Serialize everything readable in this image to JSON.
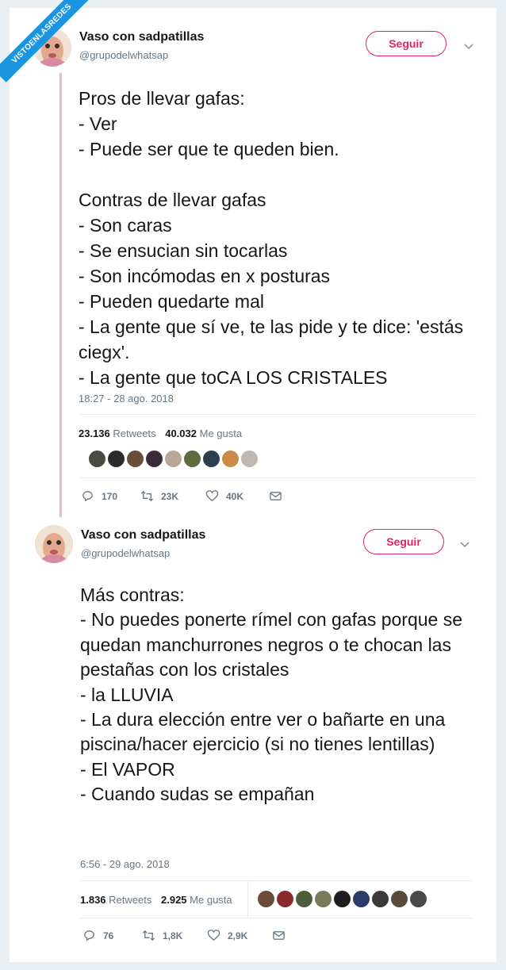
{
  "banner": {
    "text": "VISTOENLASREDES"
  },
  "tweets": [
    {
      "author": {
        "name": "Vaso con sadpatillas",
        "handle": "@grupodelwhatsap"
      },
      "follow_label": "Seguir",
      "text": "Pros de llevar gafas:\n- Ver\n- Puede ser que te queden bien.\n\nContras de llevar gafas\n- Son caras\n- Se ensucian sin tocarlas\n- Son incómodas en x posturas\n- Pueden quedarte mal\n- La gente que sí ve, te las pide y te dice: 'estás ciegx'.\n- La gente que toCA LOS CRISTALES",
      "timestamp": "18:27 - 28 ago. 2018",
      "retweets": {
        "count": "23.136",
        "label": "Retweets"
      },
      "likes": {
        "count": "40.032",
        "label": "Me gusta"
      },
      "liker_colors": [
        "#4a4a3e",
        "#2b2b2b",
        "#6b4e3a",
        "#3a2a3a",
        "#b8a69a",
        "#5d6b3e",
        "#2e3e4e",
        "#c98a4a",
        "#c0b8b0"
      ],
      "actions": {
        "replies": "170",
        "retweets": "23K",
        "likes": "40K"
      }
    },
    {
      "author": {
        "name": "Vaso con sadpatillas",
        "handle": "@grupodelwhatsap"
      },
      "follow_label": "Seguir",
      "text": "Más contras:\n- No puedes ponerte rímel con gafas porque se quedan manchurrones negros o te chocan las pestañas con los cristales\n- la LLUVIA\n- La dura elección entre ver o bañarte en una piscina/hacer ejercicio (si no tienes lentillas)\n- El VAPOR\n- Cuando sudas se empañan",
      "timestamp": "6:56 - 29 ago. 2018",
      "retweets": {
        "count": "1.836",
        "label": "Retweets"
      },
      "likes": {
        "count": "2.925",
        "label": "Me gusta"
      },
      "liker_colors": [
        "#6b4a3a",
        "#8a2a2a",
        "#4e5e3a",
        "#7a7a5a",
        "#1e1e1e",
        "#2a3a6a",
        "#3a3a3a",
        "#5a4a3a",
        "#4a4a4a"
      ],
      "actions": {
        "replies": "76",
        "retweets": "1,8K",
        "likes": "2,9K"
      }
    }
  ],
  "colors": {
    "accent": "#e0245e",
    "muted": "#657786",
    "thread_line": "#f2b5c2",
    "banner": "#1b95e0"
  },
  "icons": [
    "reply-icon",
    "retweet-icon",
    "heart-icon",
    "message-icon",
    "chevron-down-icon"
  ]
}
